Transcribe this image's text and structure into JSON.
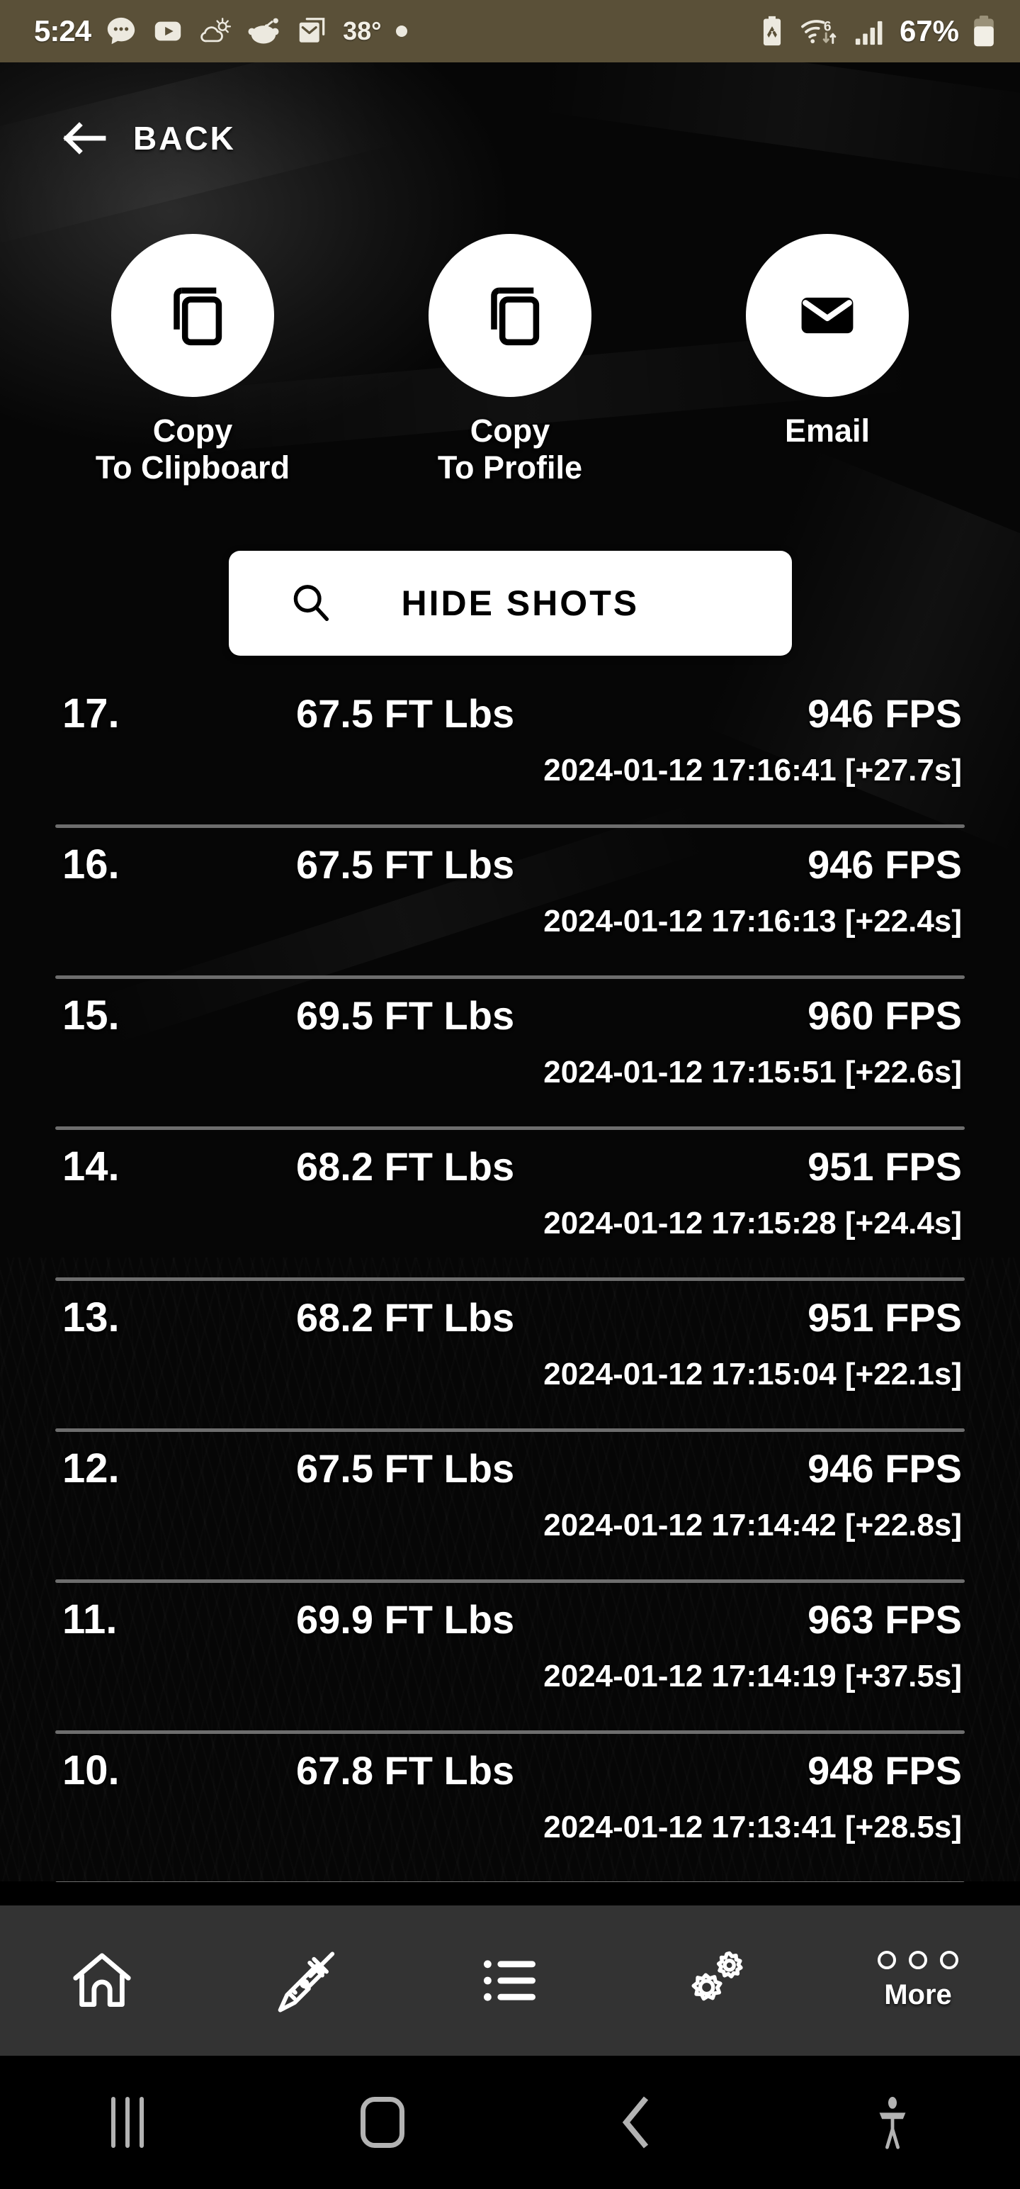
{
  "status_bar": {
    "time": "5:24",
    "temperature": "38°",
    "battery_percent": "67%",
    "left_icons": [
      "messages-icon",
      "youtube-icon",
      "weather-icon",
      "reddit-icon",
      "gmail-icon"
    ],
    "right_icons": [
      "battery-saver-icon",
      "wifi6-icon",
      "cellular-signal-icon",
      "battery-icon"
    ],
    "background_color": "#5a5038"
  },
  "header": {
    "back_label": "BACK",
    "back_icon": "arrow-left-icon"
  },
  "actions": [
    {
      "label_line1": "Copy",
      "label_line2": "To Clipboard",
      "icon": "copy-icon"
    },
    {
      "label_line1": "Copy",
      "label_line2": "To Profile",
      "icon": "copy-icon"
    },
    {
      "label_line1": "Email",
      "label_line2": "",
      "icon": "envelope-icon"
    }
  ],
  "hide_shots_button": {
    "label": "HIDE SHOTS",
    "icon": "search-icon"
  },
  "shots": [
    {
      "index": "17.",
      "energy": "67.5 FT Lbs",
      "speed": "946 FPS",
      "timestamp": "2024-01-12 17:16:41 [+27.7s]"
    },
    {
      "index": "16.",
      "energy": "67.5 FT Lbs",
      "speed": "946 FPS",
      "timestamp": "2024-01-12 17:16:13 [+22.4s]"
    },
    {
      "index": "15.",
      "energy": "69.5 FT Lbs",
      "speed": "960 FPS",
      "timestamp": "2024-01-12 17:15:51 [+22.6s]"
    },
    {
      "index": "14.",
      "energy": "68.2 FT Lbs",
      "speed": "951 FPS",
      "timestamp": "2024-01-12 17:15:28 [+24.4s]"
    },
    {
      "index": "13.",
      "energy": "68.2 FT Lbs",
      "speed": "951 FPS",
      "timestamp": "2024-01-12 17:15:04 [+22.1s]"
    },
    {
      "index": "12.",
      "energy": "67.5 FT Lbs",
      "speed": "946 FPS",
      "timestamp": "2024-01-12 17:14:42 [+22.8s]"
    },
    {
      "index": "11.",
      "energy": "69.9 FT Lbs",
      "speed": "963 FPS",
      "timestamp": "2024-01-12 17:14:19 [+37.5s]"
    },
    {
      "index": "10.",
      "energy": "67.8 FT Lbs",
      "speed": "948 FPS",
      "timestamp": "2024-01-12 17:13:41 [+28.5s]"
    }
  ],
  "bottom_nav": {
    "background_color": "#333333",
    "items": [
      {
        "icon": "home-icon",
        "label": ""
      },
      {
        "icon": "rifle-icon",
        "label": ""
      },
      {
        "icon": "list-icon",
        "label": ""
      },
      {
        "icon": "gears-icon",
        "label": ""
      },
      {
        "icon": "three-dots-icon",
        "label": "More"
      }
    ]
  },
  "system_nav": {
    "items": [
      "recents-icon",
      "home-icon",
      "back-icon",
      "accessibility-icon"
    ]
  }
}
